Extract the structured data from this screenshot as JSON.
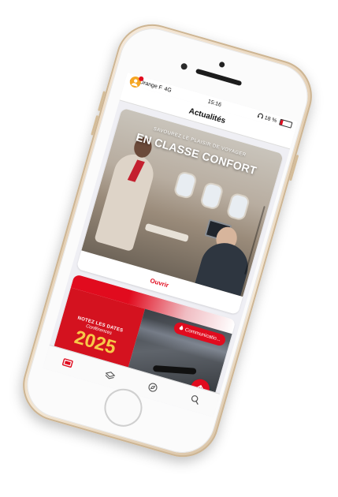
{
  "status_bar": {
    "carrier": "Orange F",
    "network": "4G",
    "time": "15:16",
    "battery": "18 %"
  },
  "nav": {
    "title": "Actualités"
  },
  "feed": {
    "cards": [
      {
        "hero_pretitle": "SAVOUREZ LE PLAISIR DE VOYAGER",
        "hero_title": "EN CLASSE CONFORT",
        "action_label": "Ouvrir"
      },
      {
        "line1": "NOTEZ LES DATES",
        "line2": "Conférences",
        "year": "2025",
        "category_badge": "Communicatio...",
        "category_icon": "flame-icon"
      }
    ]
  },
  "tab_bar": {
    "tabs": [
      {
        "icon": "news-icon",
        "active": true
      },
      {
        "icon": "layers-icon",
        "active": false
      },
      {
        "icon": "compass-icon",
        "active": false
      },
      {
        "icon": "search-icon",
        "active": false
      }
    ]
  },
  "colors": {
    "accent": "#e10b1e",
    "year_gold": "#f7c948",
    "phone_gold": "#e4cfb3"
  }
}
